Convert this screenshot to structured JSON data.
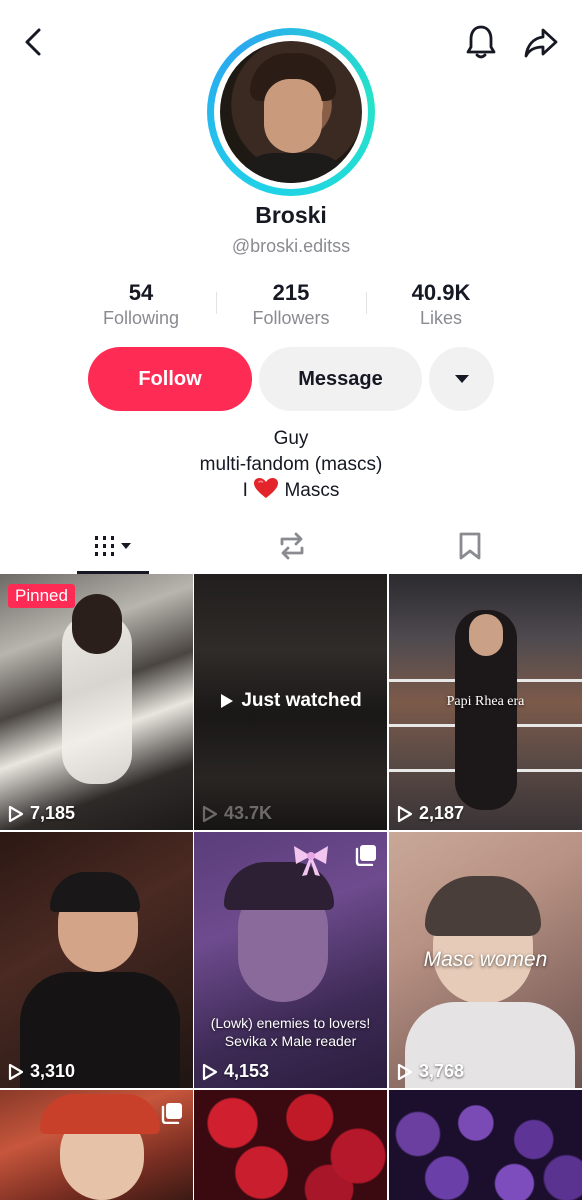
{
  "header": {
    "back_icon": "chevron-left-icon",
    "notification_icon": "bell-icon",
    "share_icon": "share-arrow-icon"
  },
  "profile": {
    "display_name": "Broski",
    "username": "@broski.editss"
  },
  "stats": [
    {
      "value": "54",
      "label": "Following"
    },
    {
      "value": "215",
      "label": "Followers"
    },
    {
      "value": "40.9K",
      "label": "Likes"
    }
  ],
  "actions": {
    "follow_label": "Follow",
    "message_label": "Message",
    "more_icon": "caret-down-icon"
  },
  "bio": {
    "line1": "Guy",
    "line2": "multi-fandom (mascs)",
    "line3_before": "I",
    "line3_after": "Mascs"
  },
  "tabs": [
    {
      "name": "videos",
      "icon": "grid-icon",
      "active": true
    },
    {
      "name": "reposts",
      "icon": "repost-icon",
      "active": false
    },
    {
      "name": "favorites",
      "icon": "bookmark-icon",
      "active": false
    }
  ],
  "videos": [
    {
      "views": "7,185",
      "badge": "Pinned"
    },
    {
      "views": "43.7K",
      "overlay": "Just watched"
    },
    {
      "views": "2,187",
      "caption": "Papi Rhea era"
    },
    {
      "views": "3,310"
    },
    {
      "views": "4,153",
      "caption_line1": "(Lowk) enemies to lovers!",
      "caption_line2": "Sevika x Male reader"
    },
    {
      "views": "3,768",
      "caption": "Masc women"
    },
    {
      "views": ""
    },
    {
      "views": ""
    },
    {
      "views": ""
    }
  ],
  "colors": {
    "accent": "#fe2c55",
    "ring": "#1fd1e8",
    "secondary_text": "#8a8b91",
    "button_gray": "#f1f1f2"
  }
}
